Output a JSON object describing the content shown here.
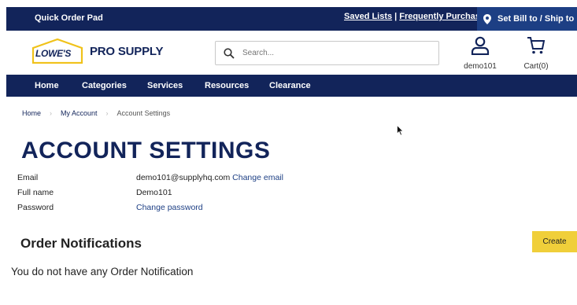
{
  "topbar": {
    "quick_order": "Quick Order Pad",
    "saved_lists": "Saved Lists",
    "separator": "|",
    "frequently_purchased": "Frequently Purchased",
    "bill_to": "Set Bill to / Ship to"
  },
  "header": {
    "logo_lowes": "LOWE'S",
    "logo_pro": "PRO SUPPLY",
    "search_placeholder": "Search...",
    "account_label": "demo101",
    "cart_label": "Cart(0)"
  },
  "nav": {
    "items": [
      "Home",
      "Categories",
      "Services",
      "Resources",
      "Clearance"
    ]
  },
  "breadcrumb": {
    "items": [
      "Home",
      "My Account",
      "Account Settings"
    ]
  },
  "page": {
    "title": "ACCOUNT SETTINGS",
    "email_label": "Email",
    "email_value": "demo101@supplyhq.com",
    "change_email": "Change email",
    "fullname_label": "Full name",
    "fullname_value": "Demo101",
    "password_label": "Password",
    "change_password": "Change password",
    "order_notifications_title": "Order Notifications",
    "create_button": "Create",
    "empty_message": "You do not have any Order Notification"
  },
  "colors": {
    "navy": "#12245a",
    "bill_to_bg": "#1d3f84",
    "accent_yellow": "#f0cf3a",
    "link_blue": "#1d3f84"
  }
}
